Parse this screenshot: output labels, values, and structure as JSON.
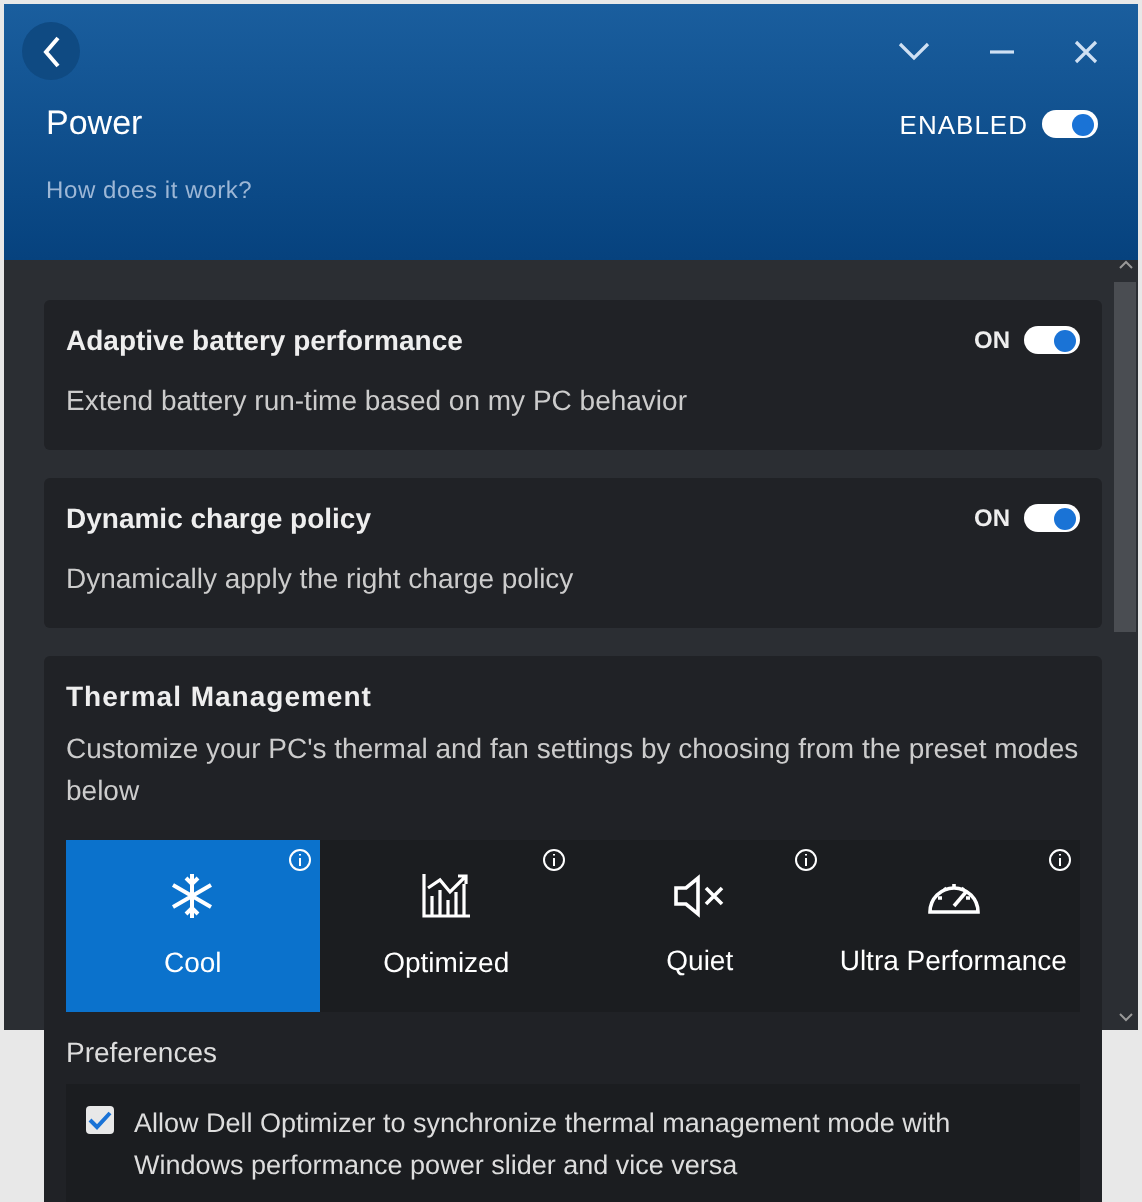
{
  "header": {
    "title": "Power",
    "help_link": "How does it work?",
    "enabled_label": "ENABLED",
    "enabled": true
  },
  "features": [
    {
      "title": "Adaptive battery performance",
      "description": "Extend battery run-time based on my PC behavior",
      "state_label": "ON",
      "on": true
    },
    {
      "title": "Dynamic charge policy",
      "description": "Dynamically apply the right charge policy",
      "state_label": "ON",
      "on": true
    }
  ],
  "thermal": {
    "title": "Thermal Management",
    "description": "Customize your PC's thermal and fan settings by choosing from the preset modes below",
    "modes": [
      {
        "kind": "cool",
        "label": "Cool",
        "selected": true
      },
      {
        "kind": "optimized",
        "label": "Optimized",
        "selected": false
      },
      {
        "kind": "quiet",
        "label": "Quiet",
        "selected": false
      },
      {
        "kind": "ultra",
        "label": "Ultra Performance",
        "selected": false
      }
    ],
    "preferences_title": "Preferences",
    "preference": {
      "label": "Allow Dell Optimizer to synchronize thermal management mode with Windows performance power slider and vice versa",
      "checked": true
    }
  }
}
